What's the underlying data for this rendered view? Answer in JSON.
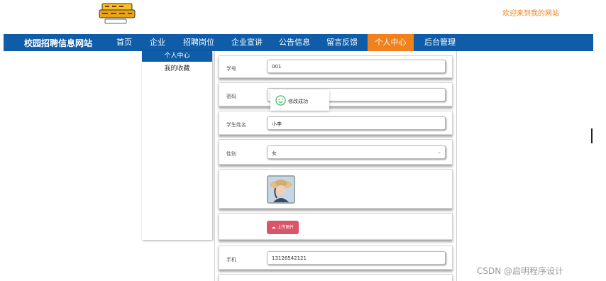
{
  "header": {
    "logo_icon": "digimon-adventure-logo",
    "welcome_text": "欢迎来到我的网站",
    "accent_color": "#f0811d"
  },
  "nav": {
    "brand_color": "#0f5ca8",
    "site_title": "校园招聘信息网站",
    "items": [
      {
        "label": "首页"
      },
      {
        "label": "企业"
      },
      {
        "label": "招聘岗位"
      },
      {
        "label": "企业宣讲"
      },
      {
        "label": "公告信息"
      },
      {
        "label": "留言反馈"
      },
      {
        "label": "个人中心",
        "active": true
      },
      {
        "label": "后台管理"
      }
    ]
  },
  "sidebar": {
    "items": [
      {
        "label": "个人中心",
        "active": true
      },
      {
        "label": "我的收藏"
      }
    ]
  },
  "form": {
    "student_id": {
      "label": "学号",
      "value": "001"
    },
    "password": {
      "label": "密码",
      "value": ""
    },
    "student_name": {
      "label": "学生姓名",
      "value": "小李"
    },
    "gender": {
      "label": "性别",
      "value": "女"
    },
    "avatar": {
      "label": "",
      "icon": "avatar-photo"
    },
    "upload": {
      "button_label": "上传图片",
      "icon": "cloud-upload-icon"
    },
    "phone": {
      "label": "手机",
      "value": "13126542121"
    }
  },
  "toast": {
    "message": "修改成功",
    "icon": "smile-icon"
  },
  "watermark": "CSDN @启明程序设计"
}
